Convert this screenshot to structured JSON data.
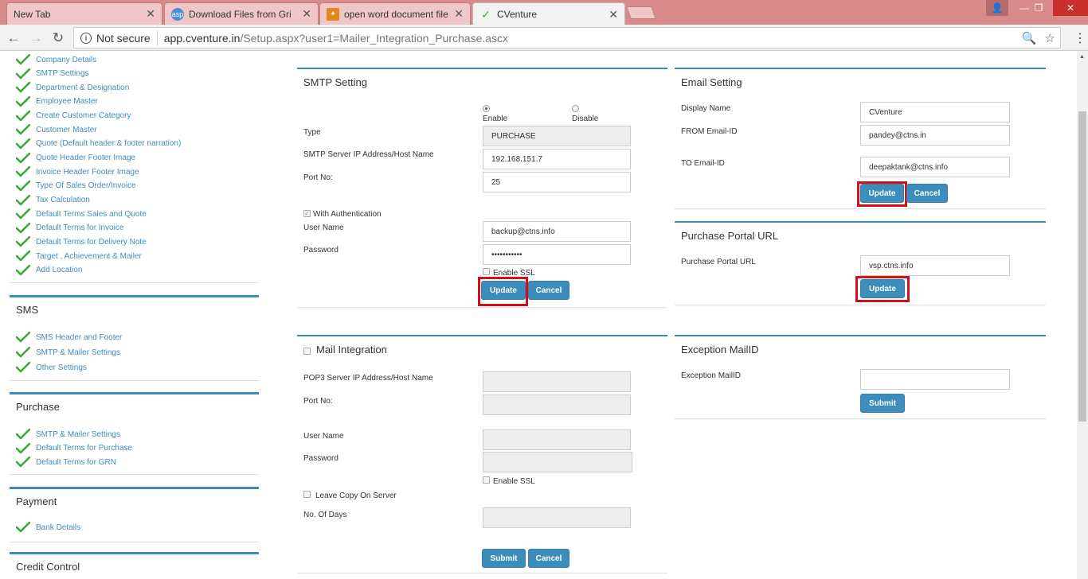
{
  "browser": {
    "tabs": [
      {
        "title": "New Tab"
      },
      {
        "title": "Download Files from Gri"
      },
      {
        "title": "open word document file"
      },
      {
        "title": "CVenture"
      }
    ],
    "address": {
      "security": "Not secure",
      "domain": "app.cventure.in",
      "path": "/Setup.aspx?user1=Mailer_Integration_Purchase.ascx"
    }
  },
  "sidebar": {
    "settings_items": [
      "Company Details",
      "SMTP Settings",
      "Department & Designation",
      "Employee Master",
      "Create Customer Category",
      "Customer Master",
      "Quote (Default header & footer narration)",
      "Quote Header Footer Image",
      "Invoice Header Footer Image",
      "Type Of Sales Order/Invoice",
      "Tax Calculation",
      "Default Terms Sales and Quote",
      "Default Terms for Invoice",
      "Default Terms for Delivery Note",
      "Target , Achievement & Mailer",
      "Add Location"
    ],
    "sms": {
      "title": "SMS",
      "items": [
        "SMS Header and Footer",
        "SMTP & Mailer Settings",
        "Other Settings"
      ]
    },
    "purchase": {
      "title": "Purchase",
      "items": [
        "SMTP & Mailer Settings",
        "Default Terms for Purchase",
        "Default Terms for GRN"
      ]
    },
    "payment": {
      "title": "Payment",
      "items": [
        "Bank Details"
      ]
    },
    "credit": {
      "title": "Credit Control"
    }
  },
  "smtp": {
    "title": "SMTP Setting",
    "enable_label": "Enable",
    "disable_label": "Disable",
    "type_label": "Type",
    "type_value": "PURCHASE",
    "host_label": "SMTP Server IP Address/Host Name",
    "host_value": "192.168.151.7",
    "port_label": "Port No:",
    "port_value": "25",
    "auth_label": "With Authentication",
    "user_label": "User Name",
    "user_value": "backup@ctns.info",
    "password_label": "Password",
    "password_value": "•••••••••••",
    "ssl_label": "Enable SSL",
    "update_label": "Update",
    "cancel_label": "Cancel"
  },
  "email": {
    "title": "Email Setting",
    "display_label": "Display Name",
    "display_value": "CVenture",
    "from_label": "FROM Email-ID",
    "from_value": "pandey@ctns.in",
    "to_label": "TO Email-ID",
    "to_value": "deepaktank@ctns.info",
    "update_label": "Update",
    "cancel_label": "Cancel"
  },
  "portal": {
    "title": "Purchase Portal URL",
    "url_label": "Purchase Portal URL",
    "url_value": "vsp.ctns.info",
    "update_label": "Update"
  },
  "mail": {
    "title": "Mail Integration",
    "pop3_label": "POP3 Server IP Address/Host Name",
    "port_label": "Port No:",
    "user_label": "User Name",
    "password_label": "Password",
    "ssl_label": "Enable SSL",
    "leave_copy_label": "Leave Copy On Server",
    "days_label": "No. Of Days",
    "submit_label": "Submit",
    "cancel_label": "Cancel"
  },
  "exception": {
    "title": "Exception MailID",
    "label": "Exception MailID",
    "submit_label": "Submit"
  },
  "colors": {
    "accent": "#3c8dbc",
    "highlight": "#d2101a",
    "check": "#3aa935"
  }
}
